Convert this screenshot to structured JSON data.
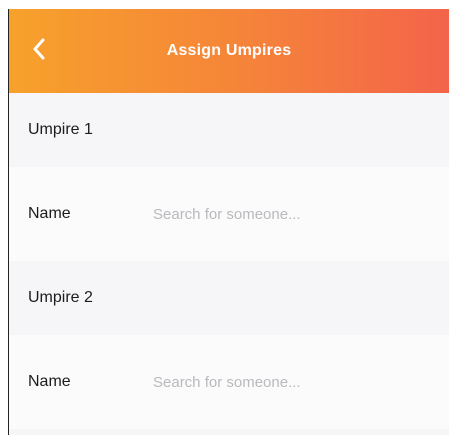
{
  "header": {
    "title": "Assign Umpires",
    "back_icon": "chevron-left-icon"
  },
  "sections": [
    {
      "label": "Umpire 1",
      "field_label": "Name",
      "placeholder": "Search for someone...",
      "value": ""
    },
    {
      "label": "Umpire 2",
      "field_label": "Name",
      "placeholder": "Search for someone...",
      "value": ""
    }
  ],
  "colors": {
    "header_gradient_start": "#f7a12b",
    "header_gradient_end": "#f3644a",
    "background": "#f6f6f8",
    "row_background": "#fbfbfc",
    "placeholder": "#b9b9be"
  }
}
